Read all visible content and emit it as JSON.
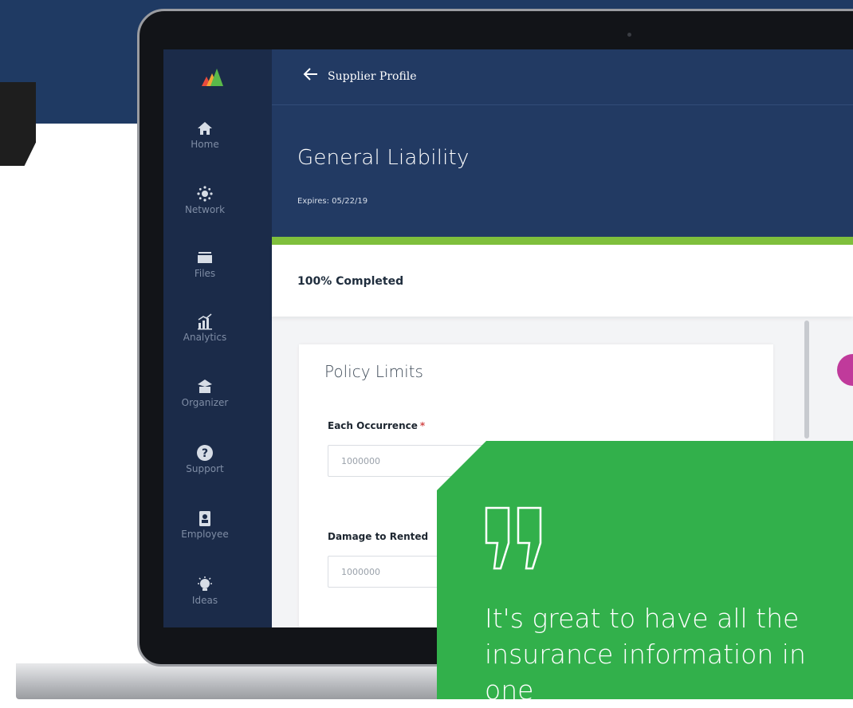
{
  "app": {
    "header_title": "Supplier Profile",
    "page_title": "General Liability",
    "expires": "Expires: 05/22/19",
    "progress_text": "100% Completed"
  },
  "sidebar": {
    "items": [
      {
        "label": "Home",
        "icon": "home-icon"
      },
      {
        "label": "Network",
        "icon": "network-icon"
      },
      {
        "label": "Files",
        "icon": "folder-icon"
      },
      {
        "label": "Analytics",
        "icon": "analytics-icon"
      },
      {
        "label": "Organizer",
        "icon": "organizer-icon"
      },
      {
        "label": "Support",
        "icon": "help-icon"
      },
      {
        "label": "Employee",
        "icon": "employee-badge-icon"
      },
      {
        "label": "Ideas",
        "icon": "lightbulb-icon"
      }
    ]
  },
  "policy_limits": {
    "title": "Policy Limits",
    "fields": [
      {
        "label": "Each Occurrence",
        "required_mark": "*",
        "value": "1000000"
      },
      {
        "label": "Damage to Rented",
        "value": "1000000"
      }
    ]
  },
  "testimonial": {
    "text": "It's great to have all the insurance information in one"
  },
  "colors": {
    "sidebar": "#1b2b49",
    "header": "#223a63",
    "progress_bar": "#7fbf3c",
    "quote_card": "#32b04b",
    "avatar": "#c03a9b"
  }
}
